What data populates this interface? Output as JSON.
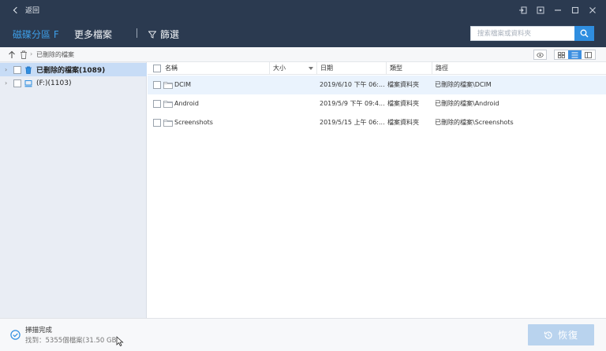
{
  "titlebar": {
    "back_label": "返回"
  },
  "nav": {
    "tab_partition": "磁碟分區 F",
    "tab_more": "更多檔案",
    "filter_label": "篩選",
    "search_placeholder": "搜索檔案或資料夾"
  },
  "toolbar": {
    "path_label": "已刪除的檔案"
  },
  "sidebar": {
    "items": [
      {
        "label": "已刪除的檔案",
        "count": "(1089)",
        "icon": "trash-icon",
        "selected": true
      },
      {
        "label": "(F:)",
        "count": "(1103)",
        "icon": "drive-icon",
        "selected": false
      }
    ]
  },
  "table": {
    "headers": {
      "name": "名稱",
      "size": "大小",
      "date": "日期",
      "type": "類型",
      "path": "路徑"
    },
    "rows": [
      {
        "name": "DCIM",
        "size": "",
        "date": "2019/6/10 下午 06:...",
        "type": "檔案資料夾",
        "path": "已刪除的檔案\\DCIM"
      },
      {
        "name": "Android",
        "size": "",
        "date": "2019/5/9 下午 09:4...",
        "type": "檔案資料夾",
        "path": "已刪除的檔案\\Android"
      },
      {
        "name": "Screenshots",
        "size": "",
        "date": "2019/5/15 上午 06:...",
        "type": "檔案資料夾",
        "path": "已刪除的檔案\\Screenshots"
      }
    ]
  },
  "status": {
    "title": "掃描完成",
    "count_text": "找到：5355個檔案(31.50 GB)",
    "recover_label": "恢復"
  },
  "colors": {
    "header_bg": "#2b3a50",
    "accent": "#3d9ee8",
    "search_button": "#2f8ee0",
    "selected_row": "#c7dcf6",
    "recover_disabled": "#b9d3ee"
  }
}
